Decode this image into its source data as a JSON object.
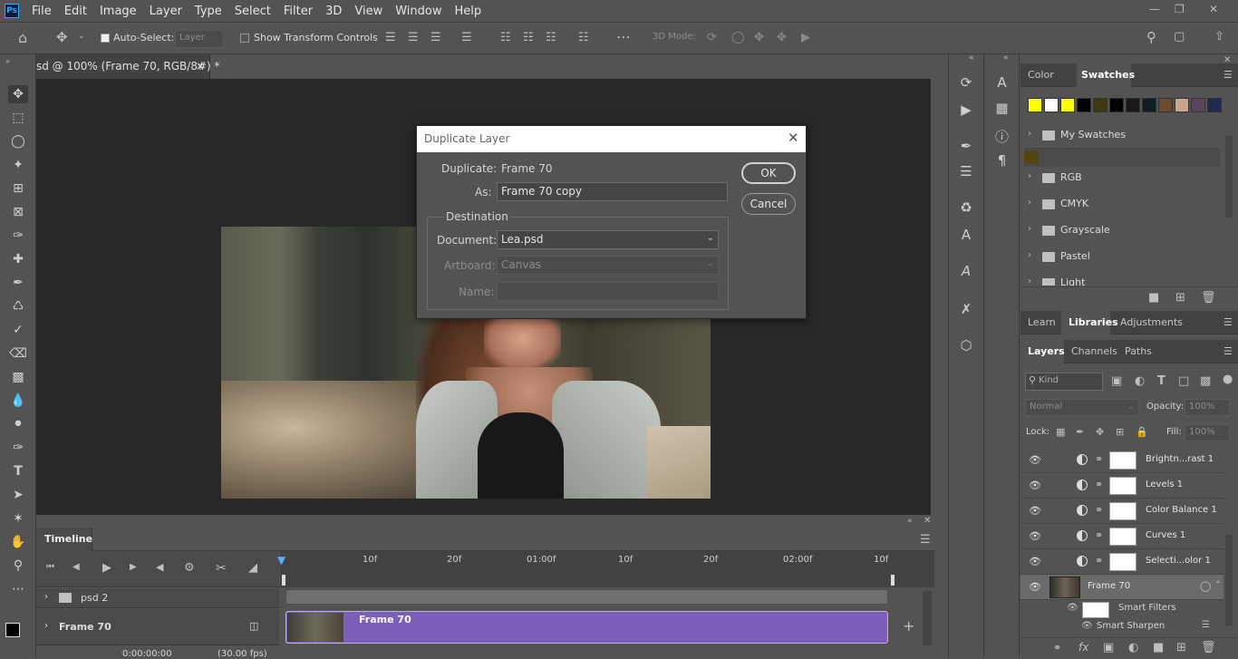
{
  "menu": {
    "items": [
      "File",
      "Edit",
      "Image",
      "Layer",
      "Type",
      "Select",
      "Filter",
      "3D",
      "View",
      "Window",
      "Help"
    ]
  },
  "options": {
    "auto_select_label": "Auto-Select:",
    "auto_select_value": "Layer",
    "show_transform_label": "Show Transform Controls",
    "mode_3d_label": "3D Mode:"
  },
  "document": {
    "tab_title": "sd @ 100% (Frame 70, RGB/8#) *"
  },
  "dialog": {
    "title": "Duplicate Layer",
    "duplicate_label": "Duplicate:",
    "duplicate_value": "Frame 70",
    "as_label": "As:",
    "as_value": "Frame 70 copy",
    "destination_label": "Destination",
    "document_label": "Document:",
    "document_value": "Lea.psd",
    "artboard_label": "Artboard:",
    "artboard_value": "Canvas",
    "name_label": "Name:",
    "name_value": "",
    "ok_label": "OK",
    "cancel_label": "Cancel"
  },
  "timeline": {
    "tab_label": "Timeline",
    "ruler_labels": [
      "10f",
      "20f",
      "01:00f",
      "10f",
      "20f",
      "02:00f",
      "10f"
    ],
    "tracks": [
      {
        "name": "psd 2"
      },
      {
        "name": "Frame 70"
      }
    ],
    "clip_label": "Frame 70",
    "timecode": "0:00:00:00",
    "fps": "(30.00 fps)"
  },
  "color_panel": {
    "tabs": [
      "Color",
      "Swatches"
    ],
    "swatches": [
      "#ffff00",
      "#ffffff",
      "#ffff00",
      "#000000",
      "#3d3a12",
      "#000000",
      "#1a1a1a",
      "#0e1e24",
      "#6b4a2e",
      "#c9a690",
      "#58465e",
      "#1f2a4a",
      "#c08a8a"
    ],
    "groups": [
      "My Swatches",
      "RGB",
      "CMYK",
      "Grayscale",
      "Pastel",
      "Light"
    ],
    "group_swatch": "#4f4613"
  },
  "libraries_panel": {
    "tabs": [
      "Learn",
      "Libraries",
      "Adjustments"
    ]
  },
  "layers_panel": {
    "tabs": [
      "Layers",
      "Channels",
      "Paths"
    ],
    "kind_label": "Kind",
    "blend_mode": "Normal",
    "opacity_label": "Opacity:",
    "opacity_value": "100%",
    "lock_label": "Lock:",
    "fill_label": "Fill:",
    "fill_value": "100%",
    "layers": [
      {
        "name": "Brightn...rast 1"
      },
      {
        "name": "Levels 1"
      },
      {
        "name": "Color Balance 1"
      },
      {
        "name": "Curves 1"
      },
      {
        "name": "Selecti...olor 1"
      }
    ],
    "frame_layer": "Frame 70",
    "smart_filters": "Smart Filters",
    "smart_sharpen": "Smart Sharpen"
  }
}
